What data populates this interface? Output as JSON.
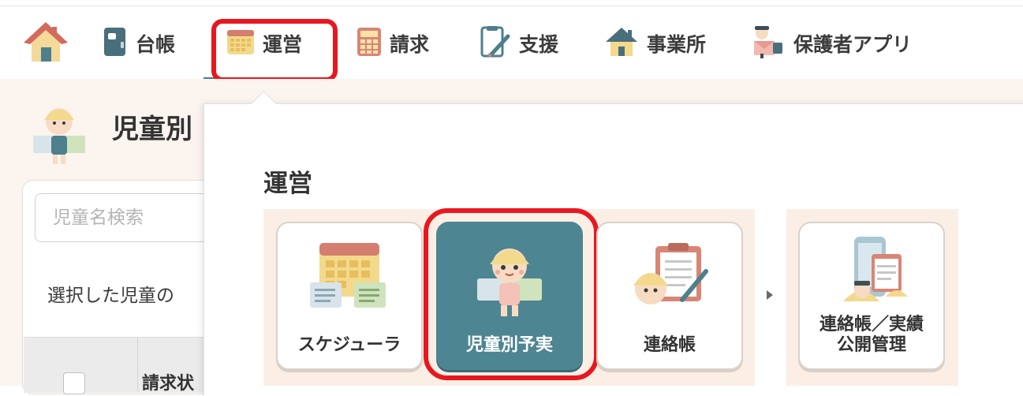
{
  "nav": {
    "items": [
      {
        "label": "",
        "icon": "home-icon"
      },
      {
        "label": "台帳",
        "icon": "ledger-icon"
      },
      {
        "label": "運営",
        "icon": "calendar-icon"
      },
      {
        "label": "請求",
        "icon": "calculator-icon"
      },
      {
        "label": "支援",
        "icon": "clipboard-pen-icon"
      },
      {
        "label": "事業所",
        "icon": "office-house-icon"
      },
      {
        "label": "保護者アプリ",
        "icon": "guardian-app-icon"
      }
    ],
    "active_index": 2
  },
  "page": {
    "title": "児童別",
    "search_placeholder": "児童名検索",
    "select_text": "選択した児童の",
    "table_header": "請求状"
  },
  "dropdown": {
    "title": "運営",
    "tiles": [
      {
        "label": "スケジューラ",
        "icon": "scheduler-icon"
      },
      {
        "label": "児童別予実",
        "icon": "child-plan-actual-icon",
        "active": true
      },
      {
        "label": "連絡帳",
        "icon": "contact-notebook-icon"
      },
      {
        "label": "連絡帳／実績\n公開管理",
        "label_line1": "連絡帳／実績",
        "label_line2": "公開管理",
        "icon": "publish-management-icon"
      }
    ]
  },
  "colors": {
    "accent": "#4e8592",
    "highlight_red": "#e8171f",
    "page_bg": "#fbf4ef",
    "group_bg": "#fbefe5"
  }
}
